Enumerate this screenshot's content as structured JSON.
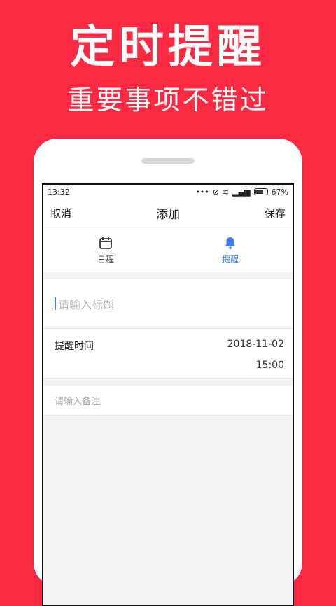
{
  "hero": {
    "title": "定时提醒",
    "subtitle": "重要事项不错过"
  },
  "status": {
    "time": "13:32",
    "battery": "67%"
  },
  "nav": {
    "cancel": "取消",
    "title": "添加",
    "save": "保存"
  },
  "tabs": [
    {
      "label": "日程",
      "icon": "calendar-icon",
      "active": false
    },
    {
      "label": "提醒",
      "icon": "bell-icon",
      "active": true
    }
  ],
  "form": {
    "title_placeholder": "请输入标题",
    "reminder_label": "提醒时间",
    "reminder_date": "2018-11-02",
    "reminder_time": "15:00",
    "note_placeholder": "请输入备注"
  },
  "colors": {
    "background": "#fb2a42",
    "accent": "#3a7cf5"
  }
}
